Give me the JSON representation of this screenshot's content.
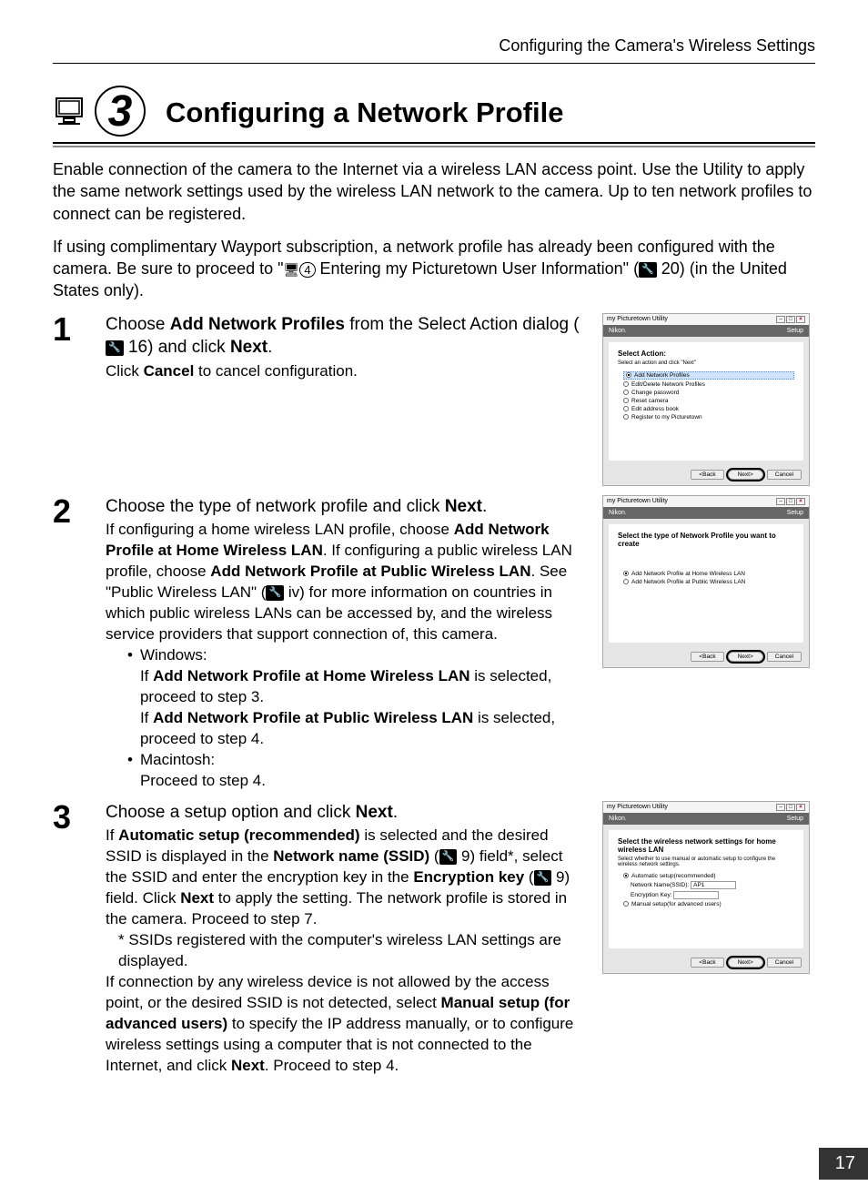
{
  "header": {
    "section_title": "Configuring the Camera's Wireless Settings"
  },
  "title": {
    "step_number": "3",
    "heading": "Configuring a Network Profile"
  },
  "intro": {
    "para1": "Enable connection of the camera to the Internet via a wireless LAN access point. Use the Utility to apply the same network settings used by the wireless LAN network to the camera. Up to ten network profiles to connect can be registered.",
    "para2_a": "If using complimentary Wayport subscription, a network profile has already been configured with the camera. Be sure to proceed to \"",
    "para2_step_ref": "4",
    "para2_b": " Entering my Picturetown User Information\" (",
    "para2_page_ref": " 20) (in the United States only)."
  },
  "steps": [
    {
      "number": "1",
      "main_a": "Choose ",
      "main_bold": "Add Network Profiles",
      "main_b": " from the Select Action dialog (",
      "main_page_ref": " 16) and click ",
      "main_bold2": "Next",
      "main_c": ".",
      "sub_a": "Click ",
      "sub_bold": "Cancel",
      "sub_b": " to cancel configuration."
    },
    {
      "number": "2",
      "main_a": "Choose the type of network profile and click ",
      "main_bold": "Next",
      "main_b": ".",
      "sub_para_a": "If configuring a home wireless LAN profile, choose ",
      "sub_bold1": "Add Network Profile at Home Wireless LAN",
      "sub_para_b": ". If configuring a public wireless LAN profile, choose ",
      "sub_bold2": "Add Network Profile at Public Wireless LAN",
      "sub_para_c": ". See \"Public Wireless LAN\" (",
      "sub_page_ref": " iv) for more information on countries in which public wireless LANs can be accessed by, and the wireless service providers that support connection of, this camera.",
      "bullet1_label": "Windows:",
      "bullet1_line1_a": "If ",
      "bullet1_line1_bold": "Add Network Profile at Home Wireless LAN",
      "bullet1_line1_b": " is selected, proceed to step 3.",
      "bullet1_line2_a": "If ",
      "bullet1_line2_bold": "Add Network Profile at Public Wireless LAN",
      "bullet1_line2_b": " is selected, proceed to step 4.",
      "bullet2_label": "Macintosh:",
      "bullet2_line": "Proceed to step 4."
    },
    {
      "number": "3",
      "main_a": "Choose a setup option and click ",
      "main_bold": "Next",
      "main_b": ".",
      "sub_a": "If ",
      "sub_bold1": "Automatic setup (recommended)",
      "sub_b": " is selected and the desired SSID is displayed in the ",
      "sub_bold2": "Network name (SSID)",
      "sub_c": " (",
      "sub_ref1": " 9) field*, select the SSID and enter the encryption key in the ",
      "sub_bold3": "Encryption key",
      "sub_d": " (",
      "sub_ref2": " 9) field. Click ",
      "sub_bold4": "Next",
      "sub_e": " to apply the setting. The network profile is stored in the camera. Proceed to step 7.",
      "footnote": "* SSIDs registered with the computer's wireless LAN settings are displayed.",
      "sub2_a": "If connection by any wireless device is not allowed by the access point, or the desired SSID is not detected, select ",
      "sub2_bold": "Manual setup (for advanced users)",
      "sub2_b": " to specify the IP address manually, or to configure wireless settings using a computer that is not connected to the Internet, and click ",
      "sub2_bold2": "Next",
      "sub2_c": ". Proceed to step 4."
    }
  ],
  "dialogs": {
    "common": {
      "app_title": "my Picturetown Utility",
      "brand": "Nikon.",
      "setup_label": "Setup",
      "back_btn": "<Back",
      "next_btn": "Next>",
      "cancel_btn": "Cancel"
    },
    "d1": {
      "heading": "Select Action:",
      "sub": "Select an action and click \"Next\"",
      "opts": [
        "Add Network Profiles",
        "Edit/Delete Network Profiles",
        "Change password",
        "Reset camera",
        "Edit address book",
        "Register to my Picturetown"
      ]
    },
    "d2": {
      "heading": "Select the type of Network Profile you want to create",
      "opts": [
        "Add Network Profile at Home Wireless LAN",
        "Add Network Profile at Public Wireless LAN"
      ]
    },
    "d3": {
      "heading": "Select the wireless network settings for home wireless LAN",
      "sub": "Select whether to use manual or automatic setup to configure the wireless network settings.",
      "opt1": "Automatic setup(recommended)",
      "field1_label": "Network Name(SSID):",
      "field1_value": "AP1",
      "field2_label": "Encryption Key:",
      "opt2": "Manual setup(for advanced users)"
    }
  },
  "page_number": "17"
}
